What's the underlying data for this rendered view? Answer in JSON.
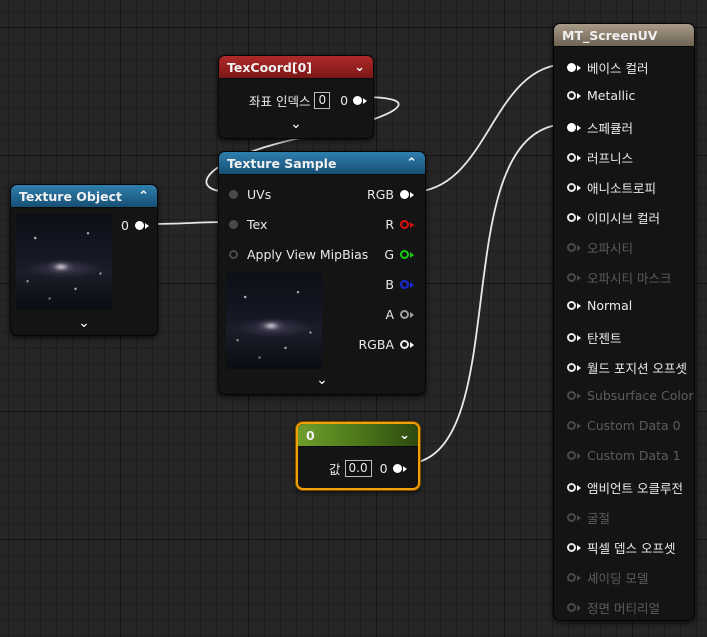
{
  "texcoord": {
    "title": "TexCoord[0]",
    "index_label": "좌표 인덱스",
    "index_value": "0",
    "output_label": "0"
  },
  "texture_sample": {
    "title": "Texture Sample",
    "inputs": [
      "UVs",
      "Tex",
      "Apply View MipBias"
    ],
    "outputs": [
      "RGB",
      "R",
      "G",
      "B",
      "A",
      "RGBA"
    ]
  },
  "texture_object": {
    "title": "Texture Object",
    "output_label": "0"
  },
  "constant": {
    "title": "0",
    "value_label": "값",
    "value": "0.0",
    "output_label": "0"
  },
  "material": {
    "title": "MT_ScreenUV",
    "pins": [
      {
        "label": "베이스 컬러",
        "enabled": true,
        "connected": true
      },
      {
        "label": "Metallic",
        "enabled": true,
        "connected": false
      },
      {
        "label": "스페큘러",
        "enabled": true,
        "connected": true
      },
      {
        "label": "러프니스",
        "enabled": true,
        "connected": false
      },
      {
        "label": "애니소트로피",
        "enabled": true,
        "connected": false
      },
      {
        "label": "이미시브 컬러",
        "enabled": true,
        "connected": false
      },
      {
        "label": "오파시티",
        "enabled": false,
        "connected": false
      },
      {
        "label": "오파시티 마스크",
        "enabled": false,
        "connected": false
      },
      {
        "label": "Normal",
        "enabled": true,
        "connected": false
      },
      {
        "label": "탄젠트",
        "enabled": true,
        "connected": false
      },
      {
        "label": "월드 포지션 오프셋",
        "enabled": true,
        "connected": false
      },
      {
        "label": "Subsurface Color",
        "enabled": false,
        "connected": false
      },
      {
        "label": "Custom Data 0",
        "enabled": false,
        "connected": false
      },
      {
        "label": "Custom Data 1",
        "enabled": false,
        "connected": false
      },
      {
        "label": "앰비언트 오클루전",
        "enabled": true,
        "connected": false
      },
      {
        "label": "굴절",
        "enabled": false,
        "connected": false
      },
      {
        "label": "픽셀 뎁스 오프셋",
        "enabled": true,
        "connected": false
      },
      {
        "label": "셰이딩 모델",
        "enabled": false,
        "connected": false
      },
      {
        "label": "정면 머티리얼",
        "enabled": false,
        "connected": false
      }
    ]
  },
  "colors": {
    "texcoord_header": "#8e1d1d",
    "texture_header": "#1f5f86",
    "constant_header": "#4f7a1e",
    "material_header": "#8a7c6a",
    "selection": "#f0a000",
    "wire": "#e8e8e8"
  }
}
